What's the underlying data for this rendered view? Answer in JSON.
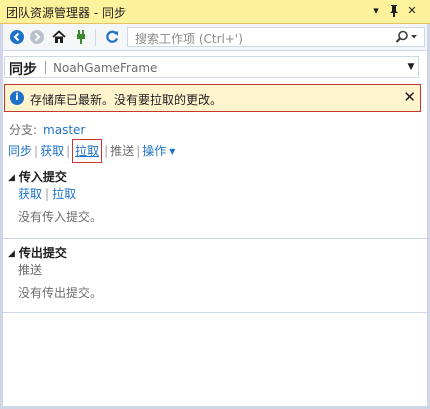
{
  "window": {
    "title": "团队资源管理器 - 同步",
    "pin_glyph": "▾",
    "dock_glyph": "ᵠ",
    "close_glyph": "✕"
  },
  "toolbar": {
    "search_placeholder": "搜索工作项 (Ctrl+')"
  },
  "context": {
    "page": "同步",
    "repository": "NoahGameFrame"
  },
  "notification": {
    "message": "存储库已最新。没有要拉取的更改。",
    "close_glyph": "✕"
  },
  "branch": {
    "label": "分支:",
    "name": "master"
  },
  "actions": {
    "sync": "同步",
    "fetch": "获取",
    "pull": "拉取",
    "push": "推送",
    "more": "操作"
  },
  "incoming": {
    "title": "传入提交",
    "fetch": "获取",
    "pull": "拉取",
    "empty": "没有传入提交。"
  },
  "outgoing": {
    "title": "传出提交",
    "push": "推送",
    "empty": "没有传出提交。"
  },
  "colors": {
    "title_bar": "#fff29d",
    "link": "#1e72c8",
    "notice_bg": "#fff4ce",
    "highlight_border": "#c6382d"
  }
}
